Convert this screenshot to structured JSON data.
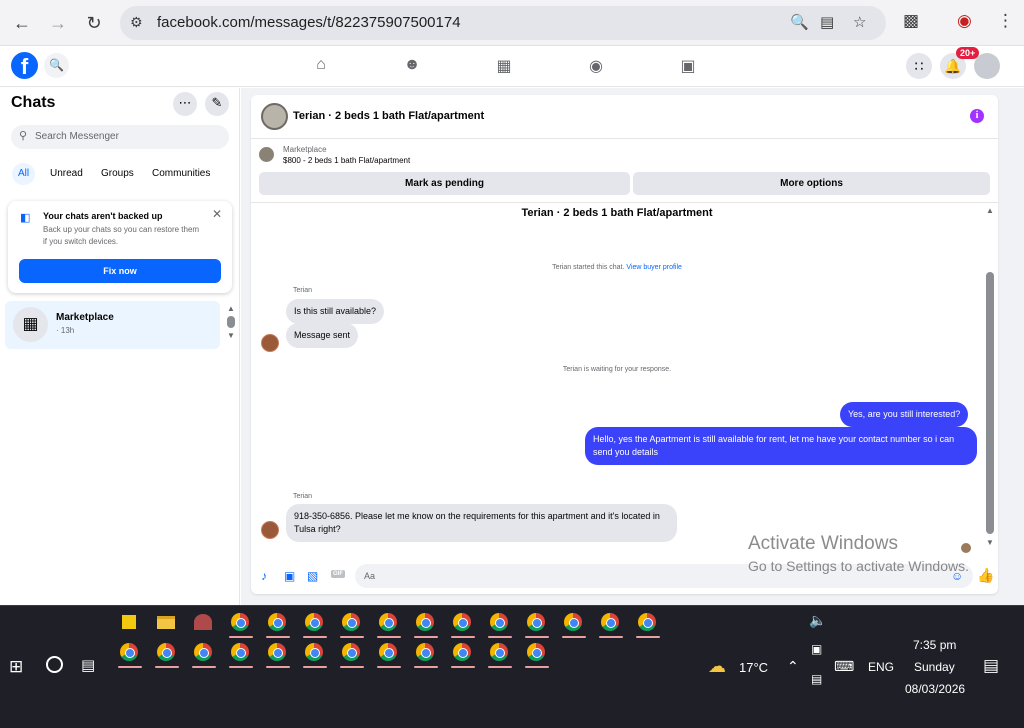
{
  "browser": {
    "url": "facebook.com/messages/t/822375907500174",
    "back_icon": "arrow-left",
    "forward_icon": "arrow-right",
    "reload_icon": "reload"
  },
  "fb": {
    "logo": "f",
    "notification_badge": "20+"
  },
  "sidebar": {
    "title": "Chats",
    "search_placeholder": "Search Messenger",
    "filters": [
      "All",
      "Unread",
      "Groups",
      "Communities"
    ],
    "backup": {
      "title": "Your chats aren't backed up",
      "desc": "Back up your chats so you can restore them if you switch devices.",
      "button": "Fix now"
    },
    "chats": [
      {
        "name": "Marketplace",
        "time": "· 13h"
      }
    ]
  },
  "conversation": {
    "header_title": "Terian · 2 beds 1 bath Flat/apartment",
    "marketplace_label": "Marketplace",
    "listing": "$800 - 2 beds 1 bath Flat/apartment",
    "mark_pending": "Mark as pending",
    "more_options": "More options",
    "title": "Terian · 2 beds 1 bath Flat/apartment",
    "started": "Terian started this chat.",
    "view_profile": "View buyer profile",
    "sender": "Terian",
    "msg1": "Is this still available?",
    "msg2": "Message sent",
    "waiting": "Terian is waiting for your response.",
    "out1": "Yes, are you still interested?",
    "out2": "Hello, yes the Apartment is still available for rent, let me have your contact number so i can send you details",
    "sender2": "Terian",
    "msg3": "918-350-6856. Please let me know on the requirements for this apartment and it's located in Tulsa right?",
    "composer_placeholder": "Aa",
    "gif_label": "GIF"
  },
  "watermark": {
    "line1": "Activate Windows",
    "line2": "Go to Settings to activate Windows."
  },
  "taskbar": {
    "temperature": "17°C",
    "language": "ENG",
    "time": "7:35 pm",
    "day": "Sunday",
    "date": "08/03/2026"
  }
}
